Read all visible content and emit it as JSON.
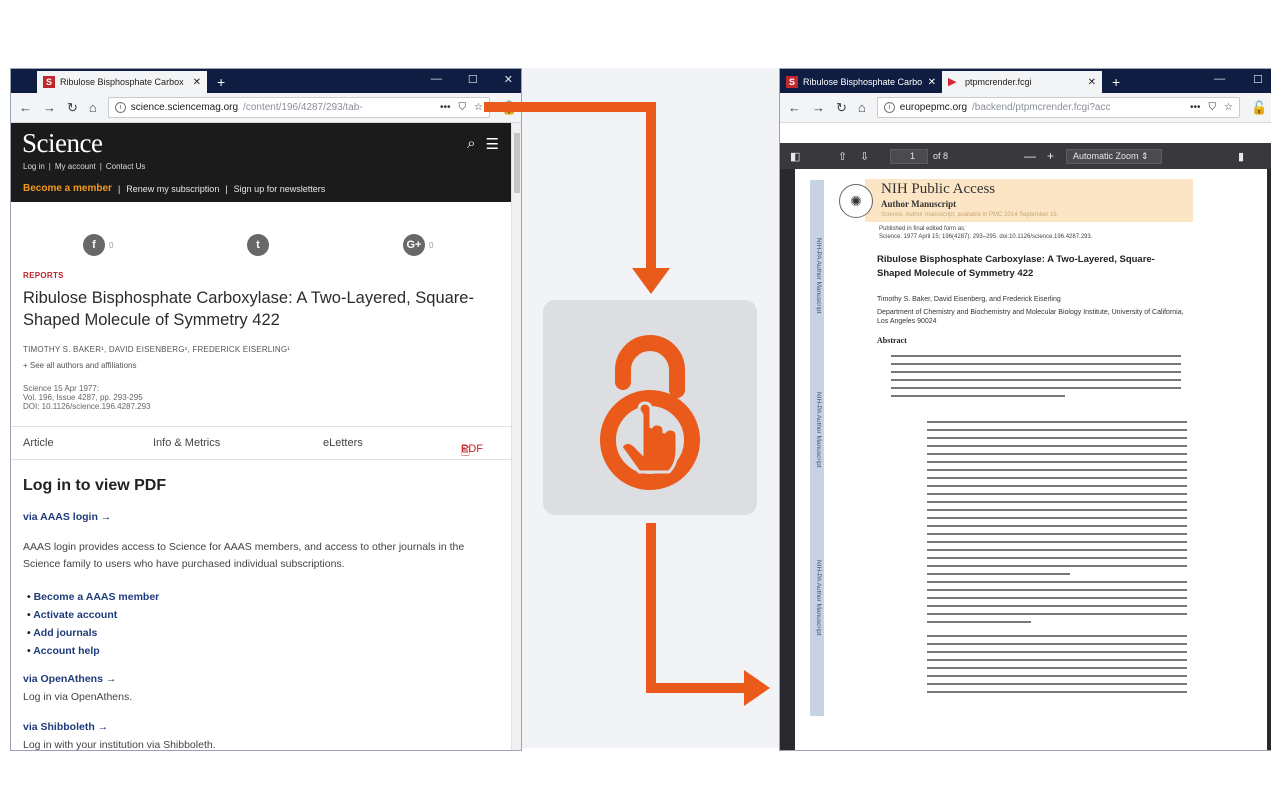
{
  "left_browser": {
    "tab_title": "Ribulose Bisphosphate Carbox",
    "tab_favicon": "S",
    "url_domain": "science.sciencemag.org",
    "url_path": "/content/196/4287/293/tab-",
    "site": {
      "logo": "Science",
      "links": [
        "Log in",
        "|",
        "My account",
        "|",
        "Contact Us"
      ],
      "become_member": "Become a member",
      "renew": "Renew my subscription",
      "signup": "Sign up for newsletters",
      "share_counts": [
        "0",
        "",
        "0"
      ]
    },
    "article": {
      "category": "REPORTS",
      "title": "Ribulose Bisphosphate Carboxylase: A Two-Layered, Square-Shaped Molecule of Symmetry 422",
      "authors": "TIMOTHY S. BAKER¹, DAVID EISENBERG¹, FREDERICK EISERLING¹",
      "see_all": "+ See all authors and affiliations",
      "meta": [
        "Science  15 Apr 1977:",
        "Vol. 196, Issue 4287, pp. 293-295",
        "DOI: 10.1126/science.196.4287.293"
      ],
      "tabs": [
        "Article",
        "Info & Metrics",
        "eLetters",
        "PDF"
      ]
    },
    "login": {
      "heading": "Log in to view PDF",
      "via_aaas": "via AAAS login →",
      "desc": "AAAS login provides access to Science for AAAS members, and access to other journals in the Science family to users who have purchased individual subscriptions.",
      "links": [
        "Become a AAAS member",
        "Activate account",
        "Add journals",
        "Account help"
      ],
      "via_openathens": "via OpenAthens →",
      "openathens_desc": "Log in via OpenAthens.",
      "via_shibboleth": "via Shibboleth →",
      "shibboleth_desc": "Log in with your institution via Shibboleth."
    }
  },
  "right_browser": {
    "tab1_title": "Ribulose Bisphosphate Carbo",
    "tab1_favicon": "S",
    "tab2_title": "ptpmcrender.fcgi",
    "url_domain": "europepmc.org",
    "url_path": "/backend/ptpmcrender.fcgi?acc",
    "pdf_toolbar": {
      "page": "1",
      "of": "of 8",
      "zoom": "Automatic Zoom"
    },
    "document": {
      "header": "NIH Public Access",
      "subheader": "Author Manuscript",
      "faint_note": "Science. Author manuscript; available in PMC 2014 September 15.",
      "published_line1": "Published in final edited form as:",
      "published_line2": "Science. 1977 April 15; 196(4287): 293–295. doi:10.1126/science.196.4287.293.",
      "title": "Ribulose Bisphosphate Carboxylase: A Two-Layered, Square-Shaped Molecule of Symmetry 422",
      "authors": "Timothy S. Baker, David Eisenberg, and Frederick Eiserling",
      "affiliation": "Department of Chemistry and Biochemistry and Molecular Biology Institute, University of California, Los Angeles 90024",
      "abstract_heading": "Abstract",
      "sidebar_text": [
        "NIH-PA Author Manuscript",
        "NIH-PA Author Manuscript",
        "NIH-PA Author Manuscript"
      ]
    }
  },
  "colors": {
    "accent": "#ea5a1a",
    "titlebar": "#0f1d42",
    "science_red": "#c2242a"
  }
}
